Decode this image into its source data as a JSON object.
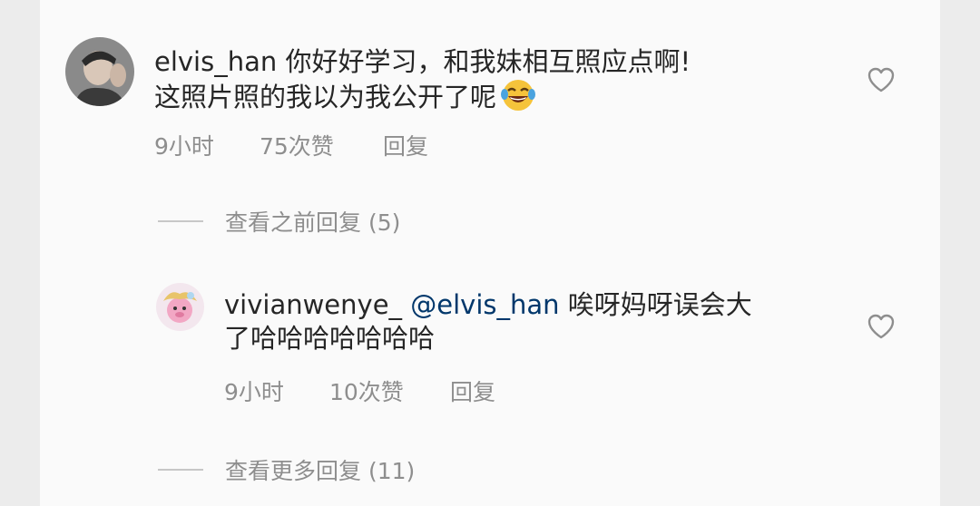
{
  "comment": {
    "username": "elvis_han",
    "text_line1": "你好好学习，和我妹相互照应点啊!",
    "text_line2": "这照片照的我以为我公开了呢",
    "emoji": "face-with-tears-of-joy",
    "time": "9小时",
    "likes": "75次赞",
    "reply_label": "回复"
  },
  "view_previous": {
    "label": "查看之前回复 (5)"
  },
  "reply": {
    "username": "vivianwenye_",
    "mention": "@elvis_han",
    "text_line1": "唉呀妈呀误会大",
    "text_line2": "了哈哈哈哈哈哈哈",
    "time": "9小时",
    "likes": "10次赞",
    "reply_label": "回复"
  },
  "view_more": {
    "label": "查看更多回复 (11)"
  },
  "colors": {
    "text": "#262626",
    "muted": "#8e8e8e",
    "mention": "#00376b",
    "background": "#fafafa"
  }
}
